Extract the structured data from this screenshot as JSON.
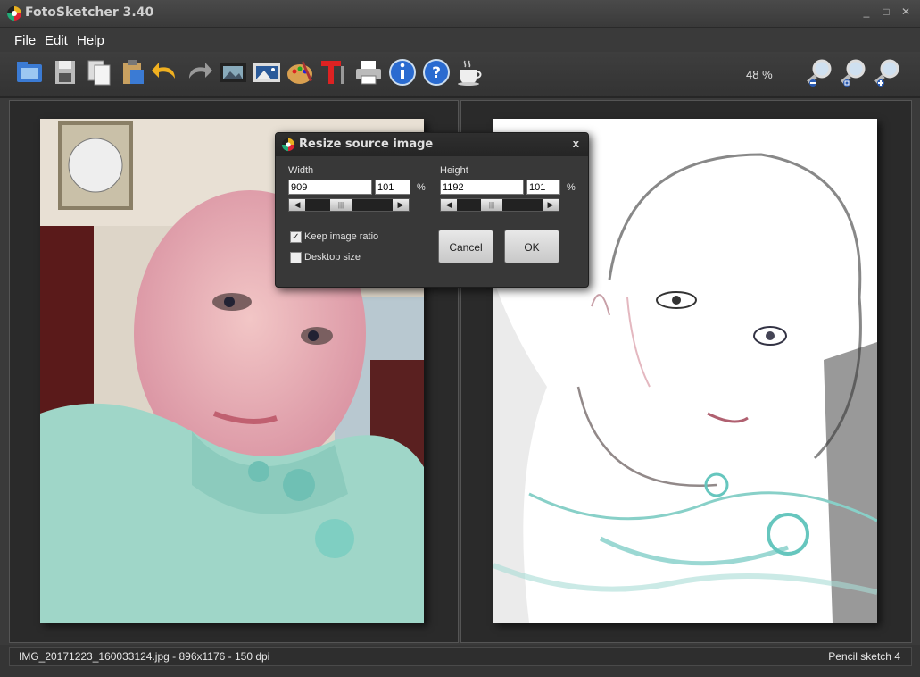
{
  "window": {
    "title": "FotoSketcher 3.40",
    "minimize": "_",
    "restore": "□",
    "close": "✕"
  },
  "menu": [
    "File",
    "Edit",
    "Help"
  ],
  "toolbar": {
    "icons": [
      "open-icon",
      "save-icon",
      "copy-icon",
      "paste-icon",
      "undo-icon",
      "redo-icon",
      "film-icon",
      "picture-icon",
      "palette-icon",
      "text-icon",
      "print-icon",
      "info-icon",
      "help-icon",
      "coffee-icon"
    ],
    "zoom": "48 %",
    "zoom_icons": [
      "zoom-out-icon",
      "zoom-fit-icon",
      "zoom-in-icon"
    ]
  },
  "dialog": {
    "title": "Resize source image",
    "close": "x",
    "width_label": "Width",
    "width_value": "909",
    "width_pct": "101",
    "height_label": "Height",
    "height_value": "1192",
    "height_pct": "101",
    "pct_symbol": "%",
    "keep_ratio_label": "Keep image ratio",
    "keep_ratio_checked": true,
    "desktop_size_label": "Desktop size",
    "desktop_size_checked": false,
    "cancel": "Cancel",
    "ok": "OK",
    "scroll_left": "◀",
    "scroll_right": "▶",
    "scroll_thumb": "|||"
  },
  "status": {
    "left": "IMG_20171223_160033124.jpg - 896x1176 - 150 dpi",
    "right": "Pencil sketch 4"
  }
}
